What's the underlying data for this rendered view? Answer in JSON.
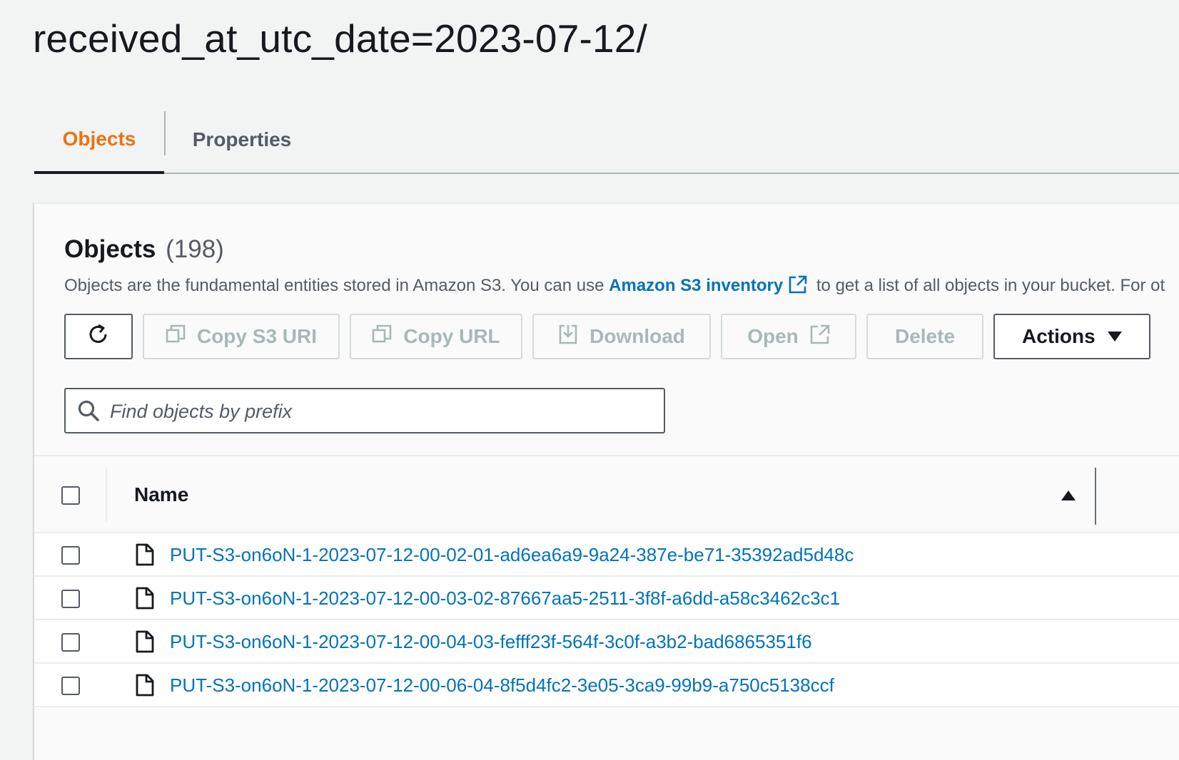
{
  "page": {
    "title": "received_at_utc_date=2023-07-12/"
  },
  "tabs": [
    {
      "label": "Objects",
      "active": true
    },
    {
      "label": "Properties",
      "active": false
    }
  ],
  "objects_panel": {
    "heading": "Objects",
    "count": "(198)",
    "description_prefix": "Objects are the fundamental entities stored in Amazon S3. You can use ",
    "inventory_link": "Amazon S3 inventory",
    "description_suffix": " to get a list of all objects in your bucket. For ot"
  },
  "toolbar": {
    "refresh_icon": "refresh-icon",
    "copy_s3_uri": "Copy S3 URI",
    "copy_url": "Copy URL",
    "download": "Download",
    "open": "Open",
    "delete": "Delete",
    "actions": "Actions"
  },
  "search": {
    "placeholder": "Find objects by prefix",
    "value": ""
  },
  "table": {
    "header_name": "Name",
    "sort": "ascending",
    "rows": [
      {
        "name": "PUT-S3-on6oN-1-2023-07-12-00-02-01-ad6ea6a9-9a24-387e-be71-35392ad5d48c"
      },
      {
        "name": "PUT-S3-on6oN-1-2023-07-12-00-03-02-87667aa5-2511-3f8f-a6dd-a58c3462c3c1"
      },
      {
        "name": "PUT-S3-on6oN-1-2023-07-12-00-04-03-fefff23f-564f-3c0f-a3b2-bad6865351f6"
      },
      {
        "name": "PUT-S3-on6oN-1-2023-07-12-00-06-04-8f5d4fc2-3e05-3ca9-99b9-a750c5138ccf"
      }
    ]
  },
  "colors": {
    "active_tab": "#ec7211",
    "link": "#0073bb",
    "background": "#f2f3f3",
    "disabled_text": "#aab7b8"
  }
}
